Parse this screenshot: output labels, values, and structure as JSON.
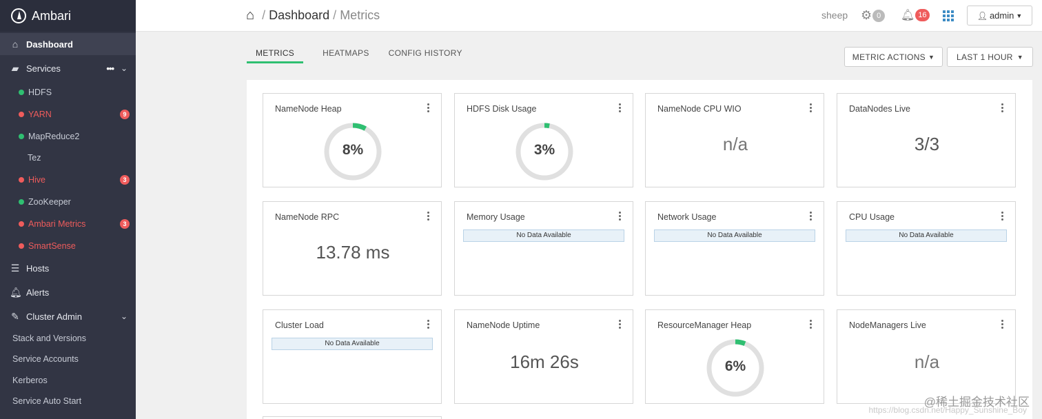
{
  "brand": {
    "name": "Ambari"
  },
  "nav": {
    "dashboard": "Dashboard",
    "services": "Services",
    "hosts": "Hosts",
    "alerts": "Alerts",
    "cluster_admin": "Cluster Admin"
  },
  "services": [
    {
      "name": "HDFS",
      "status": "ok",
      "badge": ""
    },
    {
      "name": "YARN",
      "status": "err",
      "badge": "9"
    },
    {
      "name": "MapReduce2",
      "status": "ok",
      "badge": ""
    },
    {
      "name": "Tez",
      "status": "none",
      "badge": ""
    },
    {
      "name": "Hive",
      "status": "err",
      "badge": "3"
    },
    {
      "name": "ZooKeeper",
      "status": "ok",
      "badge": ""
    },
    {
      "name": "Ambari Metrics",
      "status": "err",
      "badge": "3"
    },
    {
      "name": "SmartSense",
      "status": "err",
      "badge": ""
    }
  ],
  "admin_items": [
    "Stack and Versions",
    "Service Accounts",
    "Kerberos",
    "Service Auto Start"
  ],
  "topbar": {
    "breadcrumb_root": "Dashboard",
    "breadcrumb_current": "Metrics",
    "cluster_name": "sheep",
    "ops_count": "0",
    "alerts_count": "16",
    "user": "admin"
  },
  "tabs": [
    "METRICS",
    "HEATMAPS",
    "CONFIG HISTORY"
  ],
  "actions": {
    "metric_actions": "METRIC ACTIONS",
    "time_range": "LAST 1 HOUR"
  },
  "no_data_text": "No Data Available",
  "widgets": [
    {
      "title": "NameNode Heap",
      "kind": "donut",
      "percent": 8,
      "value": "8%"
    },
    {
      "title": "HDFS Disk Usage",
      "kind": "donut",
      "percent": 3,
      "value": "3%"
    },
    {
      "title": "NameNode CPU WIO",
      "kind": "text",
      "value": "n/a"
    },
    {
      "title": "DataNodes Live",
      "kind": "text",
      "value": "3/3"
    },
    {
      "title": "NameNode RPC",
      "kind": "text",
      "value": "13.78 ms"
    },
    {
      "title": "Memory Usage",
      "kind": "nodata"
    },
    {
      "title": "Network Usage",
      "kind": "nodata"
    },
    {
      "title": "CPU Usage",
      "kind": "nodata"
    },
    {
      "title": "Cluster Load",
      "kind": "nodata"
    },
    {
      "title": "NameNode Uptime",
      "kind": "text",
      "value": "16m 26s"
    },
    {
      "title": "ResourceManager Heap",
      "kind": "donut",
      "percent": 6,
      "value": "6%"
    },
    {
      "title": "NodeManagers Live",
      "kind": "text",
      "value": "n/a"
    }
  ],
  "watermark": "@稀土掘金技术社区",
  "watermark_url": "https://blog.csdn.net/Happy_Sunshine_Boy",
  "colors": {
    "sidebar_bg": "#323544",
    "ok": "#2fbf71",
    "error": "#ef5c5c",
    "donut_track": "#e0e0e0",
    "donut_fill": "#2fbf71"
  }
}
